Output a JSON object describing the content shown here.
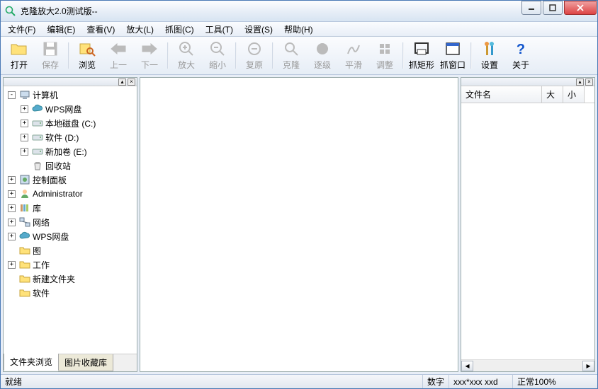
{
  "title": "克隆放大2.0测试版--",
  "menu": [
    "文件(F)",
    "编辑(E)",
    "查看(V)",
    "放大(L)",
    "抓图(C)",
    "工具(T)",
    "设置(S)",
    "帮助(H)"
  ],
  "toolbar": [
    {
      "id": "open",
      "label": "打开",
      "enabled": true,
      "icon": "folder"
    },
    {
      "id": "save",
      "label": "保存",
      "enabled": false,
      "icon": "save"
    },
    {
      "sep": true
    },
    {
      "id": "browse",
      "label": "浏览",
      "enabled": true,
      "icon": "browse"
    },
    {
      "id": "prev",
      "label": "上一",
      "enabled": false,
      "icon": "hand-left"
    },
    {
      "id": "next",
      "label": "下一",
      "enabled": false,
      "icon": "hand-right"
    },
    {
      "sep": true
    },
    {
      "id": "zoomin",
      "label": "放大",
      "enabled": false,
      "icon": "zoom-in"
    },
    {
      "id": "zoomout",
      "label": "缩小",
      "enabled": false,
      "icon": "zoom-out"
    },
    {
      "sep": true
    },
    {
      "id": "reset",
      "label": "复原",
      "enabled": false,
      "icon": "reset"
    },
    {
      "sep": true
    },
    {
      "id": "clone",
      "label": "克隆",
      "enabled": false,
      "icon": "clone"
    },
    {
      "id": "step",
      "label": "逐级",
      "enabled": false,
      "icon": "step"
    },
    {
      "id": "smooth",
      "label": "平滑",
      "enabled": false,
      "icon": "smooth"
    },
    {
      "id": "adjust",
      "label": "调整",
      "enabled": false,
      "icon": "adjust"
    },
    {
      "sep": true
    },
    {
      "id": "caprect",
      "label": "抓矩形",
      "enabled": true,
      "icon": "capture-rect"
    },
    {
      "id": "capwin",
      "label": "抓窗口",
      "enabled": true,
      "icon": "capture-win"
    },
    {
      "sep": true
    },
    {
      "id": "settings",
      "label": "设置",
      "enabled": true,
      "icon": "settings"
    },
    {
      "id": "about",
      "label": "关于",
      "enabled": true,
      "icon": "about"
    }
  ],
  "tree": [
    {
      "indent": 0,
      "exp": "-",
      "icon": "computer",
      "label": "计算机"
    },
    {
      "indent": 1,
      "exp": "+",
      "icon": "cloud",
      "label": "WPS网盘"
    },
    {
      "indent": 1,
      "exp": "+",
      "icon": "drive",
      "label": "本地磁盘 (C:)"
    },
    {
      "indent": 1,
      "exp": "+",
      "icon": "drive",
      "label": "软件 (D:)"
    },
    {
      "indent": 1,
      "exp": "+",
      "icon": "drive",
      "label": "新加卷 (E:)"
    },
    {
      "indent": 1,
      "exp": " ",
      "icon": "recycle",
      "label": "回收站"
    },
    {
      "indent": 0,
      "exp": "+",
      "icon": "cpl",
      "label": "控制面板"
    },
    {
      "indent": 0,
      "exp": "+",
      "icon": "user",
      "label": "Administrator"
    },
    {
      "indent": 0,
      "exp": "+",
      "icon": "library",
      "label": "库"
    },
    {
      "indent": 0,
      "exp": "+",
      "icon": "network",
      "label": "网络"
    },
    {
      "indent": 0,
      "exp": "+",
      "icon": "cloud",
      "label": "WPS网盘"
    },
    {
      "indent": 0,
      "exp": " ",
      "icon": "folder",
      "label": "图"
    },
    {
      "indent": 0,
      "exp": "+",
      "icon": "folder",
      "label": "工作"
    },
    {
      "indent": 0,
      "exp": " ",
      "icon": "folder",
      "label": "新建文件夹"
    },
    {
      "indent": 0,
      "exp": " ",
      "icon": "folder",
      "label": "软件"
    }
  ],
  "left_tabs": [
    "文件夹浏览",
    "图片收藏库"
  ],
  "right_columns": [
    {
      "label": "文件名",
      "width": 114
    },
    {
      "label": "大",
      "width": 30
    },
    {
      "label": "小",
      "width": 30
    }
  ],
  "status": {
    "ready": "就绪",
    "numlock": "数字",
    "dims": "xxx*xxx xxd",
    "zoom": "正常100%"
  }
}
